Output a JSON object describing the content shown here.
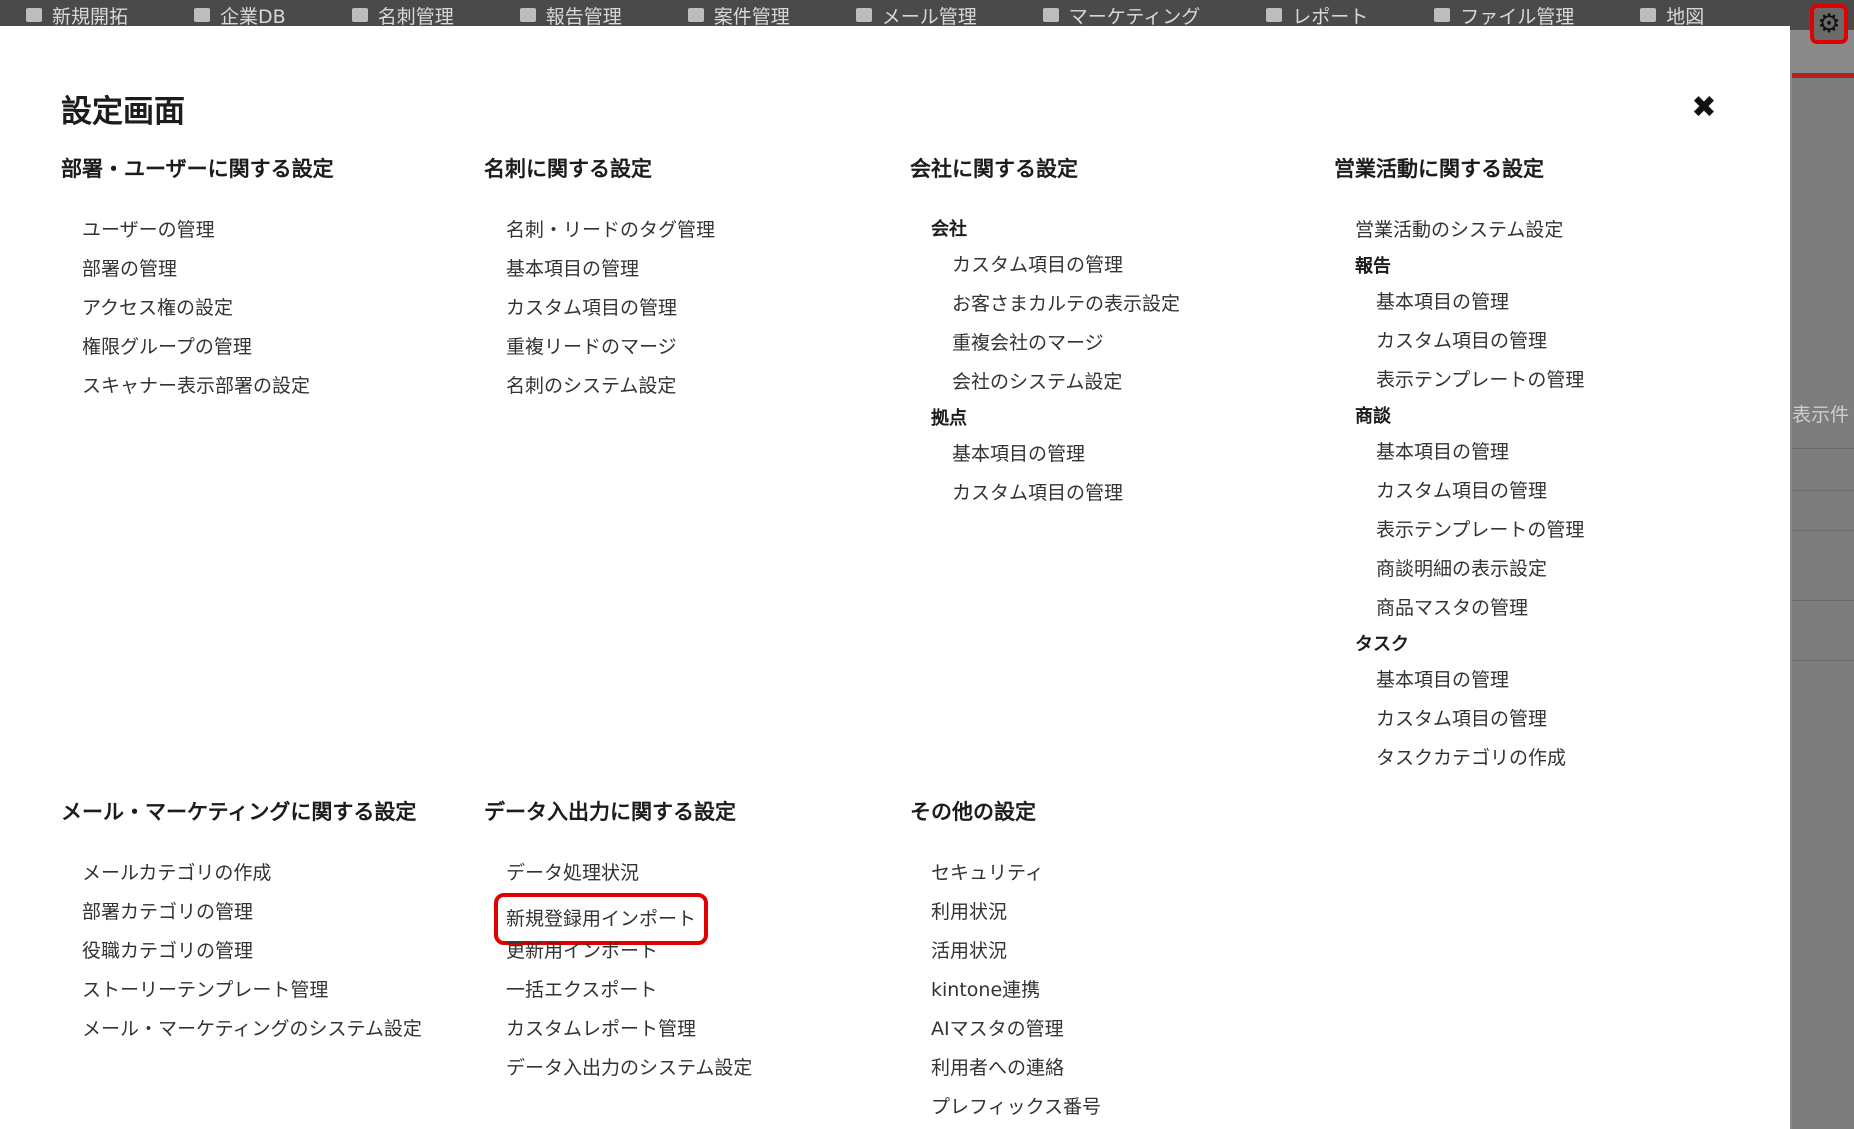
{
  "topbar": {
    "items": [
      "新規開拓",
      "企業DB",
      "名刺管理",
      "報告管理",
      "案件管理",
      "メール管理",
      "マーケティング",
      "レポート",
      "ファイル管理",
      "地図"
    ]
  },
  "background": {
    "label": "表示件"
  },
  "modal": {
    "title": "設定画面",
    "sections": {
      "dept_user": {
        "heading": "部署・ユーザーに関する設定",
        "links": [
          "ユーザーの管理",
          "部署の管理",
          "アクセス権の設定",
          "権限グループの管理",
          "スキャナー表示部署の設定"
        ]
      },
      "card": {
        "heading": "名刺に関する設定",
        "links": [
          "名刺・リードのタグ管理",
          "基本項目の管理",
          "カスタム項目の管理",
          "重複リードのマージ",
          "名刺のシステム設定"
        ]
      },
      "company": {
        "heading": "会社に関する設定",
        "groups": [
          {
            "label": "会社",
            "links": [
              "カスタム項目の管理",
              "お客さまカルテの表示設定",
              "重複会社のマージ",
              "会社のシステム設定"
            ]
          },
          {
            "label": "拠点",
            "links": [
              "基本項目の管理",
              "カスタム項目の管理"
            ]
          }
        ]
      },
      "sales": {
        "heading": "営業活動に関する設定",
        "top_link": "営業活動のシステム設定",
        "groups": [
          {
            "label": "報告",
            "links": [
              "基本項目の管理",
              "カスタム項目の管理",
              "表示テンプレートの管理"
            ]
          },
          {
            "label": "商談",
            "links": [
              "基本項目の管理",
              "カスタム項目の管理",
              "表示テンプレートの管理",
              "商談明細の表示設定",
              "商品マスタの管理"
            ]
          },
          {
            "label": "タスク",
            "links": [
              "基本項目の管理",
              "カスタム項目の管理",
              "タスクカテゴリの作成"
            ]
          }
        ]
      },
      "mail": {
        "heading": "メール・マーケティングに関する設定",
        "links": [
          "メールカテゴリの作成",
          "部署カテゴリの管理",
          "役職カテゴリの管理",
          "ストーリーテンプレート管理",
          "メール・マーケティングのシステム設定"
        ]
      },
      "data_io": {
        "heading": "データ入出力に関する設定",
        "links": [
          "データ処理状況",
          "新規登録用インポート",
          "更新用インポート",
          "一括エクスポート",
          "カスタムレポート管理",
          "データ入出力のシステム設定"
        ]
      },
      "other": {
        "heading": "その他の設定",
        "links": [
          "セキュリティ",
          "利用状況",
          "活用状況",
          "kintone連携",
          "AIマスタの管理",
          "利用者への連絡",
          "プレフィックス番号"
        ]
      }
    }
  },
  "colors": {
    "highlight": "#e00000",
    "text": "#333333",
    "heading": "#1c1c1c"
  }
}
